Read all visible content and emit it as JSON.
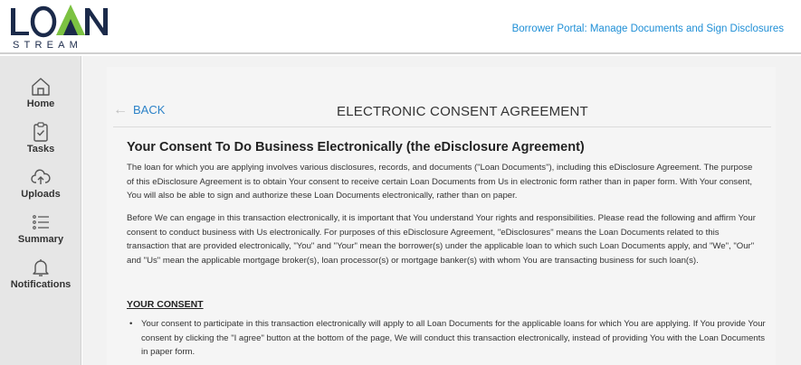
{
  "brand": {
    "logo_top": "LOAN",
    "logo_bottom": "STREAM",
    "colors": {
      "navy": "#1b2a4a",
      "green": "#7cc242",
      "accent": "#1f8fd6"
    }
  },
  "header": {
    "title": "Borrower Portal: Manage Documents and Sign Disclosures"
  },
  "sidebar": {
    "items": [
      {
        "label": "Home",
        "icon": "home-icon"
      },
      {
        "label": "Tasks",
        "icon": "clipboard-check-icon"
      },
      {
        "label": "Uploads",
        "icon": "cloud-upload-icon"
      },
      {
        "label": "Summary",
        "icon": "list-icon"
      },
      {
        "label": "Notifications",
        "icon": "bell-icon"
      }
    ]
  },
  "main": {
    "back_label": "BACK",
    "page_title": "ELECTRONIC CONSENT AGREEMENT",
    "doc_heading": "Your Consent To Do Business Electronically (the eDisclosure Agreement)",
    "paragraphs": [
      "The loan for which you are applying involves various disclosures, records, and documents (\"Loan Documents\"), including this eDisclosure Agreement. The purpose of this eDisclosure Agreement is to obtain Your consent to receive certain Loan Documents from Us in electronic form rather than in paper form. With Your consent, You will also be able to sign and authorize these Loan Documents electronically, rather than on paper.",
      "Before We can engage in this transaction electronically, it is important that You understand Your rights and responsibilities. Please read the following and affirm Your consent to conduct business with Us electronically. For purposes of this eDisclosure Agreement, \"eDisclosures\" means the Loan Documents related to this transaction that are provided electronically, \"You\" and \"Your\" mean the borrower(s) under the applicable loan to which such Loan Documents apply, and \"We\", \"Our\" and \"Us\" mean the applicable mortgage broker(s), loan processor(s) or mortgage banker(s) with whom You are transacting business for such loan(s)."
    ],
    "section_heading": "YOUR CONSENT",
    "bullets": [
      "Your consent to participate in this transaction electronically will apply to all Loan Documents for the applicable loans for which You are applying. If You provide Your consent by clicking the \"I agree\" button at the bottom of the page, We will conduct this transaction electronically, instead of providing You with the Loan Documents in paper form."
    ]
  }
}
